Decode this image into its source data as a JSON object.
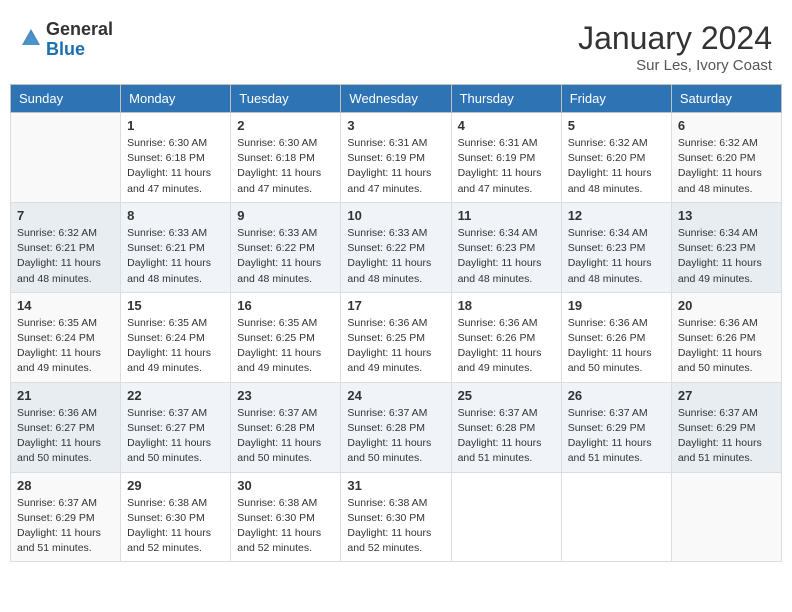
{
  "header": {
    "logo_general": "General",
    "logo_blue": "Blue",
    "month_year": "January 2024",
    "location": "Sur Les, Ivory Coast"
  },
  "weekdays": [
    "Sunday",
    "Monday",
    "Tuesday",
    "Wednesday",
    "Thursday",
    "Friday",
    "Saturday"
  ],
  "weeks": [
    [
      {
        "day": "",
        "sunrise": "",
        "sunset": "",
        "daylight": ""
      },
      {
        "day": "1",
        "sunrise": "Sunrise: 6:30 AM",
        "sunset": "Sunset: 6:18 PM",
        "daylight": "Daylight: 11 hours and 47 minutes."
      },
      {
        "day": "2",
        "sunrise": "Sunrise: 6:30 AM",
        "sunset": "Sunset: 6:18 PM",
        "daylight": "Daylight: 11 hours and 47 minutes."
      },
      {
        "day": "3",
        "sunrise": "Sunrise: 6:31 AM",
        "sunset": "Sunset: 6:19 PM",
        "daylight": "Daylight: 11 hours and 47 minutes."
      },
      {
        "day": "4",
        "sunrise": "Sunrise: 6:31 AM",
        "sunset": "Sunset: 6:19 PM",
        "daylight": "Daylight: 11 hours and 47 minutes."
      },
      {
        "day": "5",
        "sunrise": "Sunrise: 6:32 AM",
        "sunset": "Sunset: 6:20 PM",
        "daylight": "Daylight: 11 hours and 48 minutes."
      },
      {
        "day": "6",
        "sunrise": "Sunrise: 6:32 AM",
        "sunset": "Sunset: 6:20 PM",
        "daylight": "Daylight: 11 hours and 48 minutes."
      }
    ],
    [
      {
        "day": "7",
        "sunrise": "Sunrise: 6:32 AM",
        "sunset": "Sunset: 6:21 PM",
        "daylight": "Daylight: 11 hours and 48 minutes."
      },
      {
        "day": "8",
        "sunrise": "Sunrise: 6:33 AM",
        "sunset": "Sunset: 6:21 PM",
        "daylight": "Daylight: 11 hours and 48 minutes."
      },
      {
        "day": "9",
        "sunrise": "Sunrise: 6:33 AM",
        "sunset": "Sunset: 6:22 PM",
        "daylight": "Daylight: 11 hours and 48 minutes."
      },
      {
        "day": "10",
        "sunrise": "Sunrise: 6:33 AM",
        "sunset": "Sunset: 6:22 PM",
        "daylight": "Daylight: 11 hours and 48 minutes."
      },
      {
        "day": "11",
        "sunrise": "Sunrise: 6:34 AM",
        "sunset": "Sunset: 6:23 PM",
        "daylight": "Daylight: 11 hours and 48 minutes."
      },
      {
        "day": "12",
        "sunrise": "Sunrise: 6:34 AM",
        "sunset": "Sunset: 6:23 PM",
        "daylight": "Daylight: 11 hours and 48 minutes."
      },
      {
        "day": "13",
        "sunrise": "Sunrise: 6:34 AM",
        "sunset": "Sunset: 6:23 PM",
        "daylight": "Daylight: 11 hours and 49 minutes."
      }
    ],
    [
      {
        "day": "14",
        "sunrise": "Sunrise: 6:35 AM",
        "sunset": "Sunset: 6:24 PM",
        "daylight": "Daylight: 11 hours and 49 minutes."
      },
      {
        "day": "15",
        "sunrise": "Sunrise: 6:35 AM",
        "sunset": "Sunset: 6:24 PM",
        "daylight": "Daylight: 11 hours and 49 minutes."
      },
      {
        "day": "16",
        "sunrise": "Sunrise: 6:35 AM",
        "sunset": "Sunset: 6:25 PM",
        "daylight": "Daylight: 11 hours and 49 minutes."
      },
      {
        "day": "17",
        "sunrise": "Sunrise: 6:36 AM",
        "sunset": "Sunset: 6:25 PM",
        "daylight": "Daylight: 11 hours and 49 minutes."
      },
      {
        "day": "18",
        "sunrise": "Sunrise: 6:36 AM",
        "sunset": "Sunset: 6:26 PM",
        "daylight": "Daylight: 11 hours and 49 minutes."
      },
      {
        "day": "19",
        "sunrise": "Sunrise: 6:36 AM",
        "sunset": "Sunset: 6:26 PM",
        "daylight": "Daylight: 11 hours and 50 minutes."
      },
      {
        "day": "20",
        "sunrise": "Sunrise: 6:36 AM",
        "sunset": "Sunset: 6:26 PM",
        "daylight": "Daylight: 11 hours and 50 minutes."
      }
    ],
    [
      {
        "day": "21",
        "sunrise": "Sunrise: 6:36 AM",
        "sunset": "Sunset: 6:27 PM",
        "daylight": "Daylight: 11 hours and 50 minutes."
      },
      {
        "day": "22",
        "sunrise": "Sunrise: 6:37 AM",
        "sunset": "Sunset: 6:27 PM",
        "daylight": "Daylight: 11 hours and 50 minutes."
      },
      {
        "day": "23",
        "sunrise": "Sunrise: 6:37 AM",
        "sunset": "Sunset: 6:28 PM",
        "daylight": "Daylight: 11 hours and 50 minutes."
      },
      {
        "day": "24",
        "sunrise": "Sunrise: 6:37 AM",
        "sunset": "Sunset: 6:28 PM",
        "daylight": "Daylight: 11 hours and 50 minutes."
      },
      {
        "day": "25",
        "sunrise": "Sunrise: 6:37 AM",
        "sunset": "Sunset: 6:28 PM",
        "daylight": "Daylight: 11 hours and 51 minutes."
      },
      {
        "day": "26",
        "sunrise": "Sunrise: 6:37 AM",
        "sunset": "Sunset: 6:29 PM",
        "daylight": "Daylight: 11 hours and 51 minutes."
      },
      {
        "day": "27",
        "sunrise": "Sunrise: 6:37 AM",
        "sunset": "Sunset: 6:29 PM",
        "daylight": "Daylight: 11 hours and 51 minutes."
      }
    ],
    [
      {
        "day": "28",
        "sunrise": "Sunrise: 6:37 AM",
        "sunset": "Sunset: 6:29 PM",
        "daylight": "Daylight: 11 hours and 51 minutes."
      },
      {
        "day": "29",
        "sunrise": "Sunrise: 6:38 AM",
        "sunset": "Sunset: 6:30 PM",
        "daylight": "Daylight: 11 hours and 52 minutes."
      },
      {
        "day": "30",
        "sunrise": "Sunrise: 6:38 AM",
        "sunset": "Sunset: 6:30 PM",
        "daylight": "Daylight: 11 hours and 52 minutes."
      },
      {
        "day": "31",
        "sunrise": "Sunrise: 6:38 AM",
        "sunset": "Sunset: 6:30 PM",
        "daylight": "Daylight: 11 hours and 52 minutes."
      },
      {
        "day": "",
        "sunrise": "",
        "sunset": "",
        "daylight": ""
      },
      {
        "day": "",
        "sunrise": "",
        "sunset": "",
        "daylight": ""
      },
      {
        "day": "",
        "sunrise": "",
        "sunset": "",
        "daylight": ""
      }
    ]
  ]
}
